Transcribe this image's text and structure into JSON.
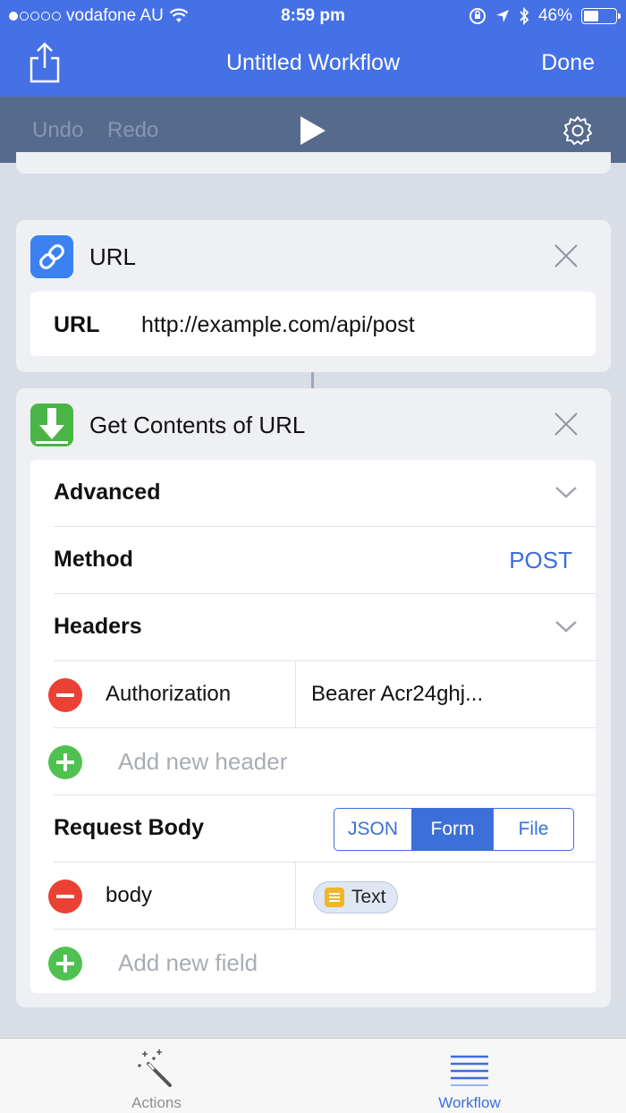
{
  "status_bar": {
    "carrier": "vodafone AU",
    "time": "8:59 pm",
    "battery": "46%",
    "battery_level": 0.46,
    "signal_bars": 1
  },
  "nav": {
    "title": "Untitled Workflow",
    "done_label": "Done"
  },
  "toolbar": {
    "undo_label": "Undo",
    "redo_label": "Redo"
  },
  "actions": {
    "url": {
      "title": "URL",
      "field_label": "URL",
      "field_value": "http://example.com/api/post"
    },
    "get_contents": {
      "title": "Get Contents of URL",
      "advanced_label": "Advanced",
      "method_label": "Method",
      "method_value": "POST",
      "headers_label": "Headers",
      "headers": [
        {
          "key": "Authorization",
          "value": "Bearer Acr24ghj..."
        }
      ],
      "add_header_placeholder": "Add new header",
      "request_body_label": "Request Body",
      "body_types": [
        "JSON",
        "Form",
        "File"
      ],
      "selected_body_type": "Form",
      "fields": [
        {
          "key": "body",
          "token_label": "Text"
        }
      ],
      "add_field_placeholder": "Add new field"
    }
  },
  "tabbar": {
    "actions_label": "Actions",
    "workflow_label": "Workflow",
    "selected": "Workflow"
  },
  "colors": {
    "nav_blue": "#4570e6",
    "toolbar_slate": "#566a8b",
    "accent": "#3c6fd8",
    "remove_red": "#eb4034",
    "add_green": "#4fc150"
  }
}
